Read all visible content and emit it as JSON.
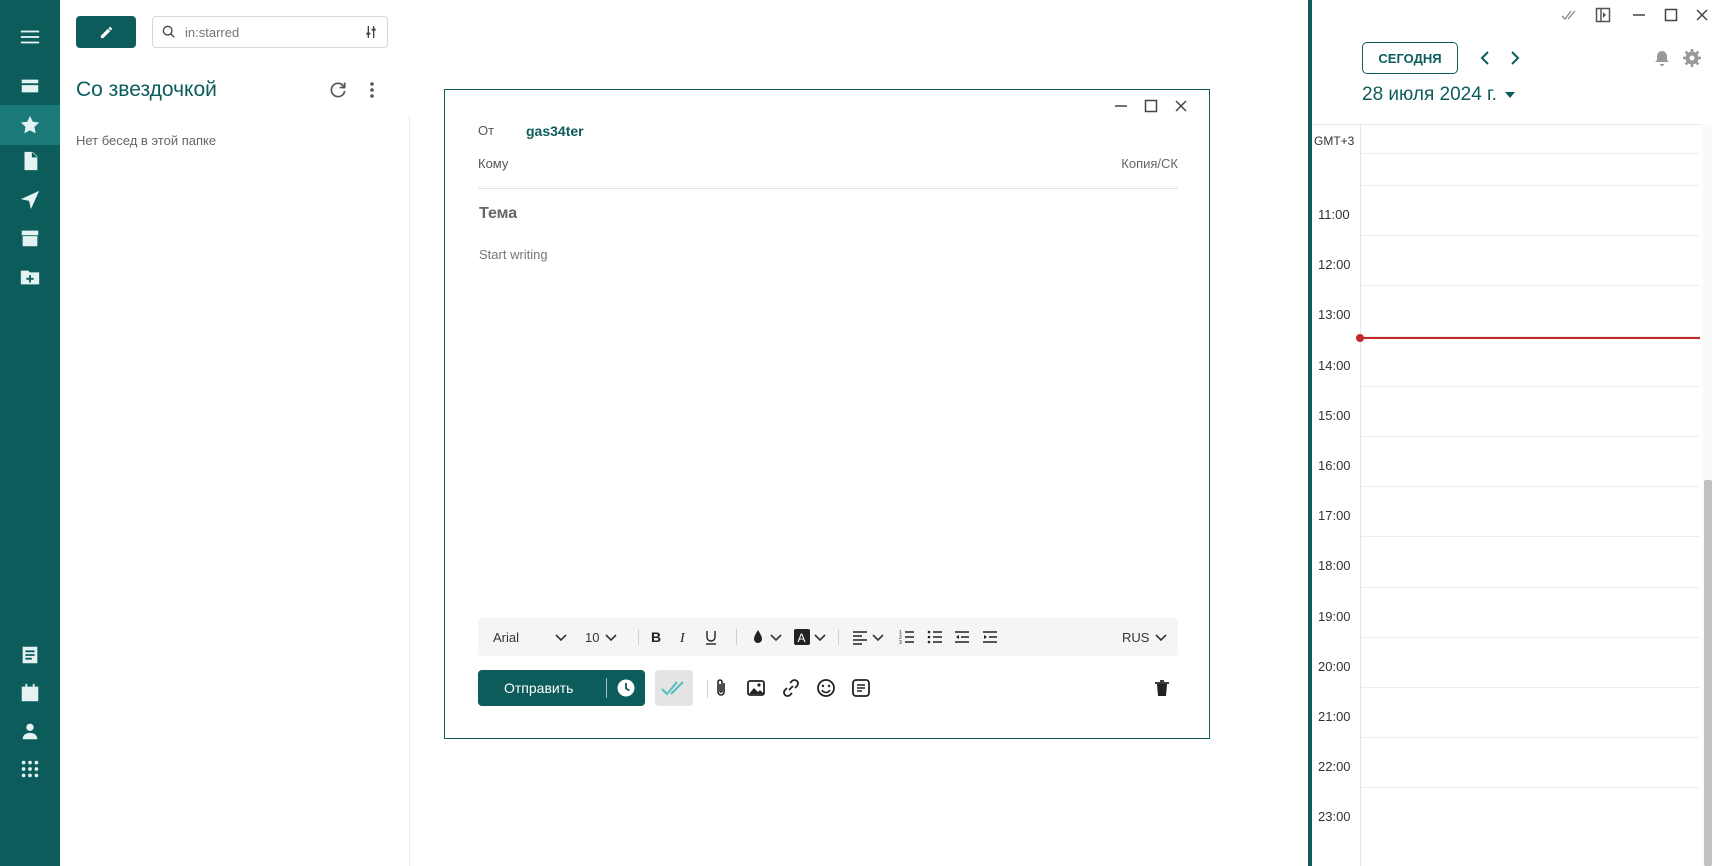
{
  "folder": {
    "search_placeholder": "in:starred",
    "title": "Со звездочкой",
    "empty_message": "Нет бесед в этой папке"
  },
  "compose": {
    "from_label": "От",
    "from_value": "gas34ter",
    "to_label": "Кому",
    "cc_label": "Копия/СК",
    "subject_placeholder": "Тема",
    "body_placeholder": "Start writing",
    "format": {
      "font": "Arial",
      "size": "10",
      "language": "RUS"
    },
    "send_label": "Отправить"
  },
  "calendar": {
    "today_label": "СЕГОДНЯ",
    "date_label": "28 июля 2024 г.",
    "timezone": "GMT+3",
    "hours": [
      "11:00",
      "12:00",
      "13:00",
      "14:00",
      "15:00",
      "16:00",
      "17:00",
      "18:00",
      "19:00",
      "20:00",
      "21:00",
      "22:00",
      "23:00"
    ]
  },
  "colors": {
    "brand": "#0d5c5c",
    "now_indicator": "#c62828"
  }
}
